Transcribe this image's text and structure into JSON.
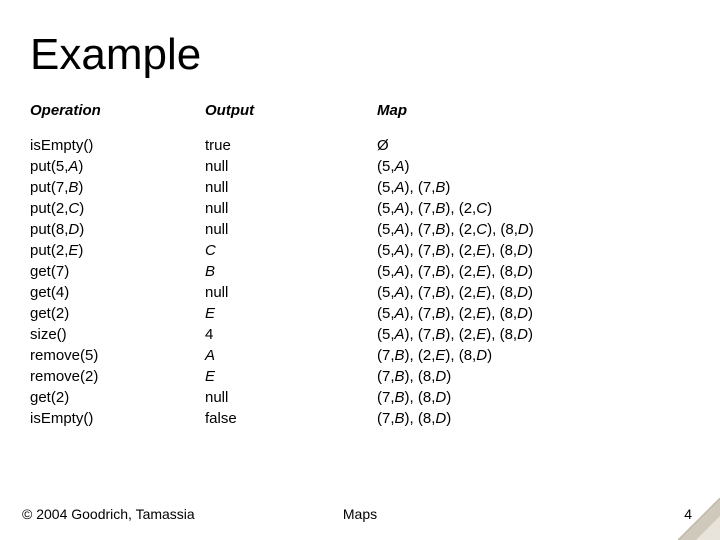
{
  "title": "Example",
  "headers": {
    "op": "Operation",
    "out": "Output",
    "map": "Map"
  },
  "rows": [
    {
      "op": "isEmpty()",
      "out_pre": "true",
      "map_html": "Ø"
    },
    {
      "op_pre": "put(5,",
      "op_ital": "A",
      "op_post": ")",
      "out_pre": "null",
      "map_html": "(5,<span class=\"ital\">A</span>)"
    },
    {
      "op_pre": "put(7,",
      "op_ital": "B",
      "op_post": ")",
      "out_pre": "null",
      "map_html": "(5,<span class=\"ital\">A</span>), (7,<span class=\"ital\">B</span>)"
    },
    {
      "op_pre": "put(2,",
      "op_ital": "C",
      "op_post": ")",
      "out_pre": "null",
      "map_html": "(5,<span class=\"ital\">A</span>), (7,<span class=\"ital\">B</span>), (2,<span class=\"ital\">C</span>)"
    },
    {
      "op_pre": "put(8,",
      "op_ital": "D",
      "op_post": ")",
      "out_pre": "null",
      "map_html": "(5,<span class=\"ital\">A</span>), (7,<span class=\"ital\">B</span>), (2,<span class=\"ital\">C</span>), (8,<span class=\"ital\">D</span>)"
    },
    {
      "op_pre": "put(2,",
      "op_ital": "E",
      "op_post": ")",
      "out_ital": "C",
      "map_html": "(5,<span class=\"ital\">A</span>), (7,<span class=\"ital\">B</span>), (2,<span class=\"ital\">E</span>), (8,<span class=\"ital\">D</span>)"
    },
    {
      "op": "get(7)",
      "out_ital": "B",
      "map_html": "(5,<span class=\"ital\">A</span>), (7,<span class=\"ital\">B</span>), (2,<span class=\"ital\">E</span>), (8,<span class=\"ital\">D</span>)"
    },
    {
      "op": "get(4)",
      "out_pre": "null",
      "map_html": "(5,<span class=\"ital\">A</span>), (7,<span class=\"ital\">B</span>), (2,<span class=\"ital\">E</span>), (8,<span class=\"ital\">D</span>)"
    },
    {
      "op": "get(2)",
      "out_ital": "E",
      "map_html": "(5,<span class=\"ital\">A</span>), (7,<span class=\"ital\">B</span>), (2,<span class=\"ital\">E</span>), (8,<span class=\"ital\">D</span>)"
    },
    {
      "op": "size()",
      "out_pre": "4",
      "map_html": "(5,<span class=\"ital\">A</span>), (7,<span class=\"ital\">B</span>), (2,<span class=\"ital\">E</span>), (8,<span class=\"ital\">D</span>)"
    },
    {
      "op": "remove(5)",
      "out_ital": "A",
      "map_html": "(7,<span class=\"ital\">B</span>), (2,<span class=\"ital\">E</span>), (8,<span class=\"ital\">D</span>)"
    },
    {
      "op": "remove(2)",
      "out_ital": "E",
      "map_html": "(7,<span class=\"ital\">B</span>), (8,<span class=\"ital\">D</span>)"
    },
    {
      "op": "get(2)",
      "out_pre": "null",
      "map_html": "(7,<span class=\"ital\">B</span>), (8,<span class=\"ital\">D</span>)"
    },
    {
      "op": "isEmpty()",
      "out_pre": "false",
      "map_html": "(7,<span class=\"ital\">B</span>), (8,<span class=\"ital\">D</span>)"
    }
  ],
  "footer": {
    "copyright": "© 2004 Goodrich, Tamassia",
    "center": "Maps",
    "page": "4"
  }
}
